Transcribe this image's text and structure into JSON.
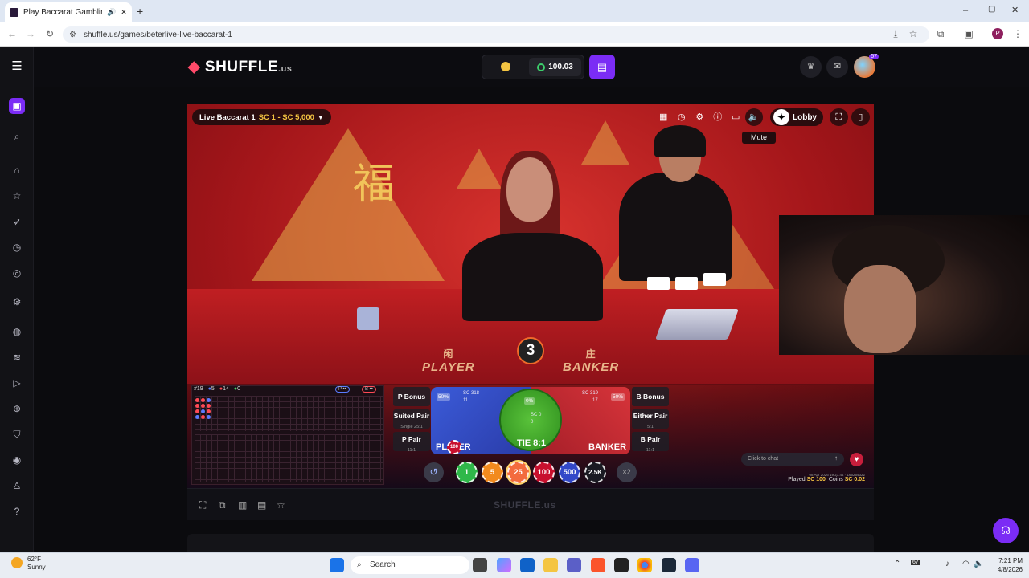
{
  "browser": {
    "tab_title": "Play Baccarat Gambling Ga",
    "new_tab": "+",
    "url": "shuffle.us/games/beterlive-live-baccarat-1",
    "window_controls": [
      "–",
      "▢",
      "✕"
    ]
  },
  "site": {
    "logo": "SHUFFLE",
    "logo_suffix": ".us",
    "balance": "100.03",
    "level_badge": "57",
    "sidebar_icons": [
      "menu-icon",
      "casino-icon",
      "search-icon",
      "home-icon",
      "star-icon",
      "rocket-icon",
      "clock-icon",
      "radar-icon",
      "settings-icon",
      "gamepad-icon",
      "stack-icon",
      "play-icon",
      "trophy-icon",
      "shield-icon",
      "globe-icon",
      "person-icon",
      "help-icon"
    ]
  },
  "game": {
    "table_name": "Live Baccarat 1",
    "limits": "SC 1 - SC 5,000",
    "lobby_label": "Lobby",
    "mute_tooltip": "Mute",
    "table_player": "PLAYER",
    "table_banker": "BANKER",
    "player_cn": "闲",
    "banker_cn": "庄",
    "fu_char": "福",
    "timer": "3",
    "road_stats": {
      "round": "#19",
      "player": "5",
      "banker": "14",
      "tie": "0"
    },
    "road_toggle": [
      "P ••",
      "B ••"
    ],
    "side_bets": {
      "p_bonus": "P Bonus",
      "suited_pair": "Suited Pair",
      "suited_pair_sub": "Single 25:1",
      "p_pair": "P Pair",
      "p_pair_sub": "11:1",
      "b_bonus": "B Bonus",
      "either_pair": "Either Pair",
      "either_pair_sub": "5:1",
      "b_pair": "B Pair",
      "b_pair_sub": "11:1"
    },
    "main_bets": {
      "player": "PLAYER",
      "player_pct": "50%",
      "player_sc": "SC 318",
      "player_count": "11",
      "banker": "BANKER",
      "banker_pct": "50%",
      "banker_sc": "SC 319",
      "banker_count": "17",
      "tie": "TIE 8:1",
      "tie_pct": "0%",
      "tie_sc": "SC 0",
      "tie_count": "0"
    },
    "placed_chip": "100",
    "chips": [
      "1",
      "5",
      "25",
      "100",
      "500",
      "2.5K"
    ],
    "double_label": "×2",
    "chat_placeholder": "Click to chat",
    "timestamp": "08 Apr 2026 19:21:44 · 165254322",
    "played_label": "Played",
    "played_value": "SC 100",
    "coins_label": "Coins",
    "coins_value": "SC 0.02",
    "footer_logo": "SHUFFLE.us"
  },
  "colors": {
    "brand_purple": "#7b2cf5",
    "player_blue": "#3b5bd8",
    "banker_red": "#d7343a",
    "tie_green": "#59c23a"
  },
  "taskbar": {
    "temp": "62°F",
    "condition": "Sunny",
    "search_placeholder": "Search",
    "time": "7:21 PM",
    "date": "4/8/2026",
    "badge": "67"
  }
}
